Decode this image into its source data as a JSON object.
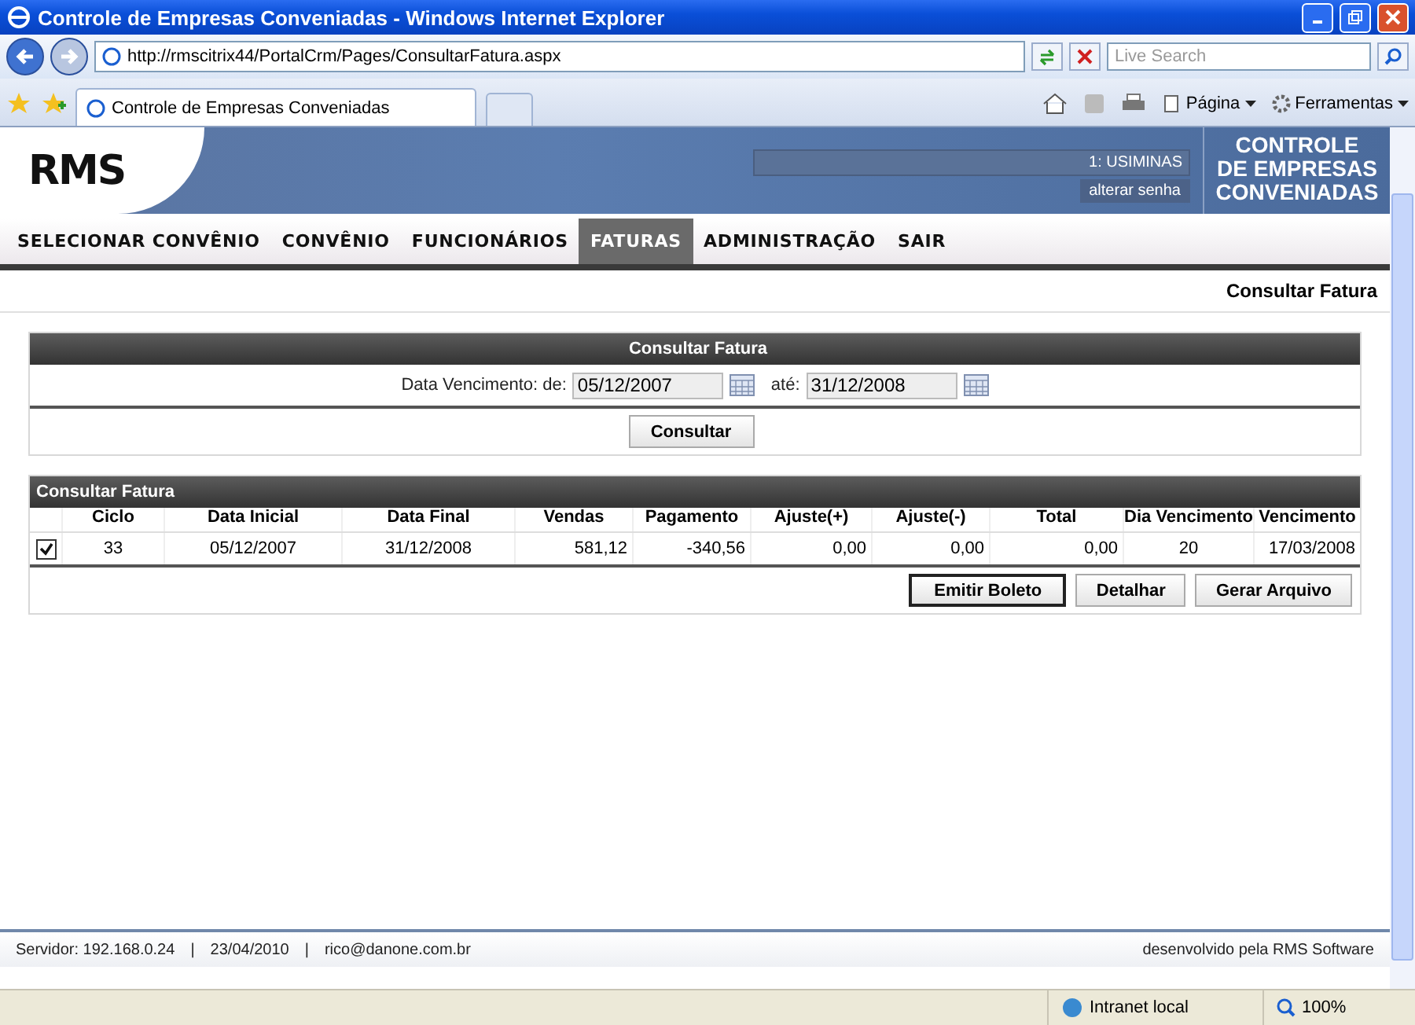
{
  "window": {
    "title": "Controle de Empresas Conveniadas - Windows Internet Explorer"
  },
  "browser": {
    "address": "http://rmscitrix44/PortalCrm/Pages/ConsultarFatura.aspx",
    "search_placeholder": "Live Search",
    "tab_title": "Controle de Empresas Conveniadas",
    "commands": [
      "Página",
      "Ferramentas"
    ]
  },
  "header": {
    "logo": "RMS",
    "user": "1: USIMINAS",
    "change_password": "alterar senha",
    "brand": [
      "CONTROLE",
      "DE EMPRESAS",
      "CONVENIADAS"
    ]
  },
  "nav": [
    {
      "label": "SELECIONAR CONVÊNIO",
      "selected": false
    },
    {
      "label": "CONVÊNIO",
      "selected": false
    },
    {
      "label": "FUNCIONÁRIOS",
      "selected": false
    },
    {
      "label": "FATURAS",
      "selected": true
    },
    {
      "label": "ADMINISTRAÇÃO",
      "selected": false
    },
    {
      "label": "SAIR",
      "selected": false
    }
  ],
  "page_title": "Consultar Fatura",
  "filter": {
    "title": "Consultar Fatura",
    "from_label": "Data Vencimento: de:",
    "from": "05/12/2007",
    "to_label": "até:",
    "to": "31/12/2008",
    "button": "Consultar"
  },
  "results": {
    "title": "Consultar Fatura",
    "columns": [
      "Ciclo",
      "Data Inicial",
      "Data Final",
      "Vendas",
      "Pagamento",
      "Ajuste(+)",
      "Ajuste(-)",
      "Total",
      "Dia Vencimento",
      "Vencimento"
    ],
    "rows": [
      {
        "checked": true,
        "cells": [
          "33",
          "05/12/2007",
          "31/12/2008",
          "581,12",
          "-340,56",
          "0,00",
          "0,00",
          "0,00",
          "20",
          "17/03/2008"
        ]
      }
    ],
    "buttons": [
      {
        "label": "Emitir Boleto",
        "selected": true
      },
      {
        "label": "Detalhar",
        "selected": false
      },
      {
        "label": "Gerar Arquivo",
        "selected": false
      }
    ]
  },
  "footer": {
    "items": [
      "Servidor: 192.168.0.24",
      "23/04/2010",
      "rico@danone.com.br"
    ],
    "separator": "|",
    "credit": "desenvolvido pela RMS Software"
  },
  "status_bar": {
    "zone": "Intranet local",
    "zoom": "100%"
  }
}
